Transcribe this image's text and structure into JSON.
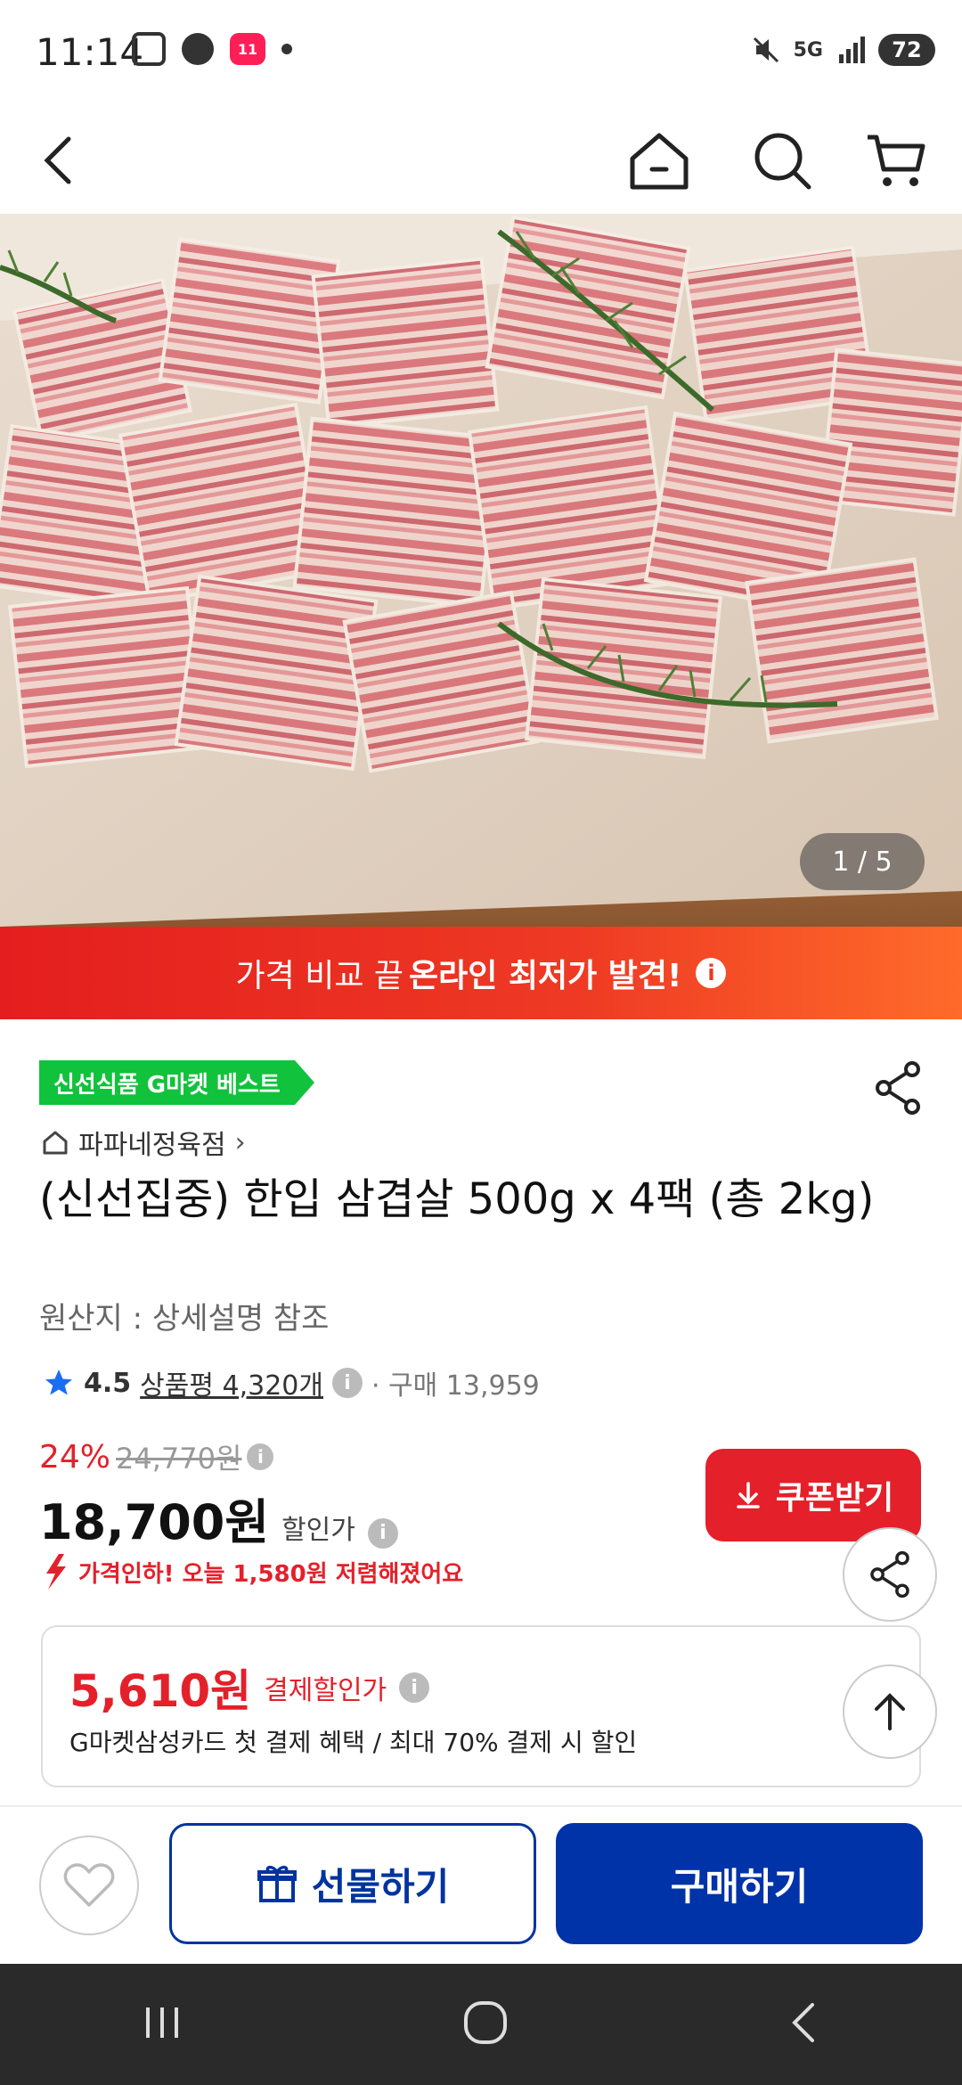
{
  "status": {
    "time": "11:14",
    "network": "5G",
    "battery": "72"
  },
  "hero": {
    "counter": "1 / 5"
  },
  "banner": {
    "prefix": "가격 비교 끝 ",
    "highlight": "온라인 최저가 발견!",
    "info_icon": "i"
  },
  "product": {
    "badge": "신선식품 G마켓 베스트",
    "store": "파파네정육점",
    "title": "(신선집중) 한입 삼겹살 500g x 4팩 (총 2kg)",
    "origin": "원산지 : 상세설명 참조",
    "rating": "4.5",
    "review_label": "상품평 4,320개",
    "purchases": "· 구매 13,959"
  },
  "pricing": {
    "discount": "24%",
    "original": "24,770원",
    "price": "18,700원",
    "price_label": "할인가",
    "drop_text": "가격인하! 오늘 1,580원 저렴해졌어요",
    "coupon_label": "쿠폰받기"
  },
  "card_offer": {
    "price": "5,610원",
    "label": "결제할인가",
    "desc": "G마켓삼성카드 첫 결제 혜택 / 최대 70% 결제 시 할인"
  },
  "bottom": {
    "gift_label": "선물하기",
    "buy_label": "구매하기"
  },
  "colors": {
    "accent_red": "#e4202a",
    "brand_blue": "#0032a8",
    "badge_green": "#11c23c"
  }
}
